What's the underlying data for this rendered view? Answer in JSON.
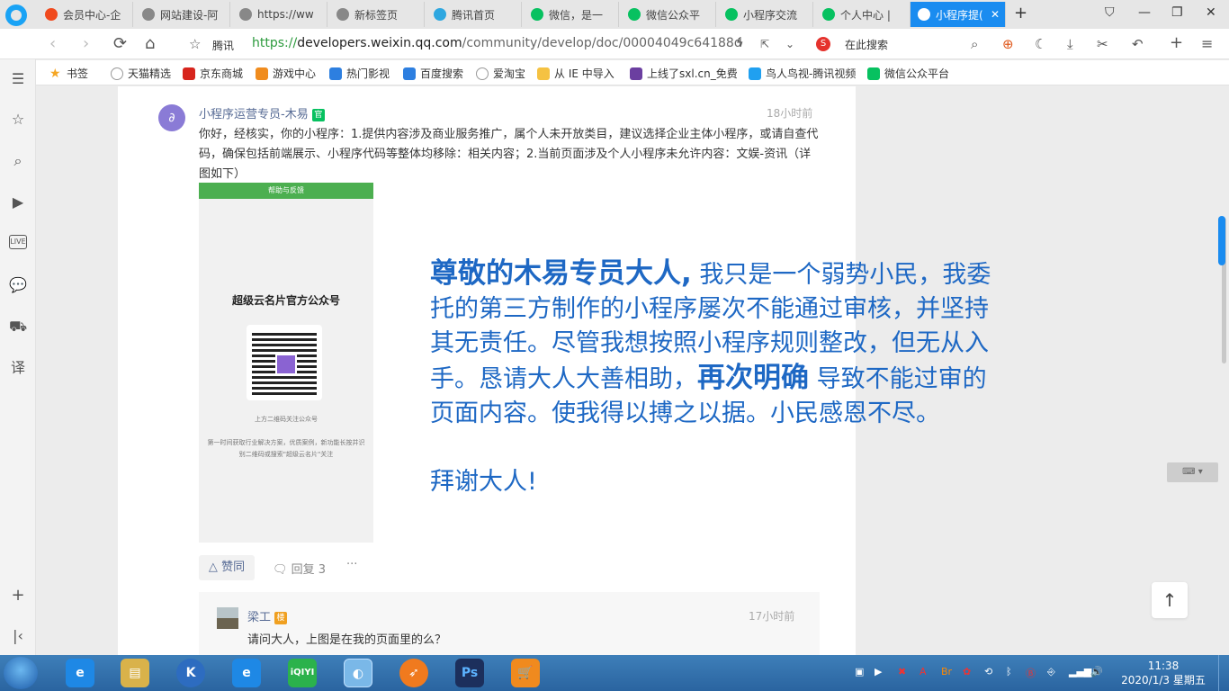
{
  "tabs": [
    {
      "label": "会员中心-企",
      "icon_color": "#f04a1e"
    },
    {
      "label": "网站建设-阿",
      "icon_color": "#888888"
    },
    {
      "label": "https://ww",
      "icon_color": "#888888"
    },
    {
      "label": "新标签页",
      "icon_color": "#888888"
    },
    {
      "label": "腾讯首页",
      "icon_color": "#2ea7e0"
    },
    {
      "label": "微信，是一",
      "icon_color": "#07c160"
    },
    {
      "label": "微信公众平",
      "icon_color": "#07c160"
    },
    {
      "label": "小程序交流",
      "icon_color": "#07c160"
    },
    {
      "label": "个人中心 |",
      "icon_color": "#07c160"
    },
    {
      "label": "小程序提(",
      "icon_color": "#ffffff",
      "active": true
    }
  ],
  "address": {
    "site_name": "腾讯",
    "url_scheme": "https://",
    "url_host": "developers.weixin.qq.com",
    "url_path": "/community/develop/doc/00004049c64188d",
    "search_placeholder": "在此搜索"
  },
  "bookmarks": [
    {
      "label": "书签",
      "icon": "star-icon",
      "color": "#f5a623"
    },
    {
      "label": "天猫精选",
      "icon": "globe-icon",
      "color": "#999999"
    },
    {
      "label": "京东商城",
      "icon": "jd-icon",
      "color": "#d7251d"
    },
    {
      "label": "游戏中心",
      "icon": "game-icon",
      "color": "#f08c1e"
    },
    {
      "label": "热门影视",
      "icon": "play-icon",
      "color": "#2d7fe0"
    },
    {
      "label": "百度搜索",
      "icon": "paw-icon",
      "color": "#2d7fe0"
    },
    {
      "label": "爱淘宝",
      "icon": "globe-icon",
      "color": "#999999"
    },
    {
      "label": "从 IE 中导入",
      "icon": "folder-icon",
      "color": "#f5c242"
    },
    {
      "label": "上线了sxl.cn_免费",
      "icon": "s-icon",
      "color": "#6b3fa0"
    },
    {
      "label": "鸟人鸟视-腾讯视频",
      "icon": "video-icon",
      "color": "#20a0f0"
    },
    {
      "label": "微信公众平台",
      "icon": "wechat-icon",
      "color": "#07c160"
    }
  ],
  "post": {
    "author": "小程序运营专员-木易",
    "official_badge": "官",
    "time": "18小时前",
    "text": "你好，经核实，你的小程序：1.提供内容涉及商业服务推广，属个人未开放类目，建议选择企业主体小程序，或请自查代码，确保包括前端展示、小程序代码等整体均移除：相关内容；2.当前页面涉及个人小程序未允许内容：文娱-资讯（详图如下）",
    "image": {
      "top_bar": "帮助与反馈",
      "title": "超级云名片官方公众号",
      "caption1": "上方二维码关注公众号",
      "caption2": "第一时间获取行业解决方案，优质案例，新功能长按并识别二维码或搜索\"超级云名片\"关注"
    },
    "like_label": "赞同",
    "reply_label": "回复 3",
    "more_label": "···"
  },
  "overlay": {
    "lead": "尊敬的木易专员大人,",
    "part1": "我只是一个弱势小民，我委托的第三方制作的小程序屡次不能通过审核，并坚持其无责任。尽管我想按照小程序规则整改，但无从入手。恳请大人大善相助，",
    "emph": "再次明确",
    "part2": "导致不能过审的页面内容。使我得以搏之以据。小民感恩不尽。",
    "thanks": "拜谢大人!"
  },
  "sub_reply": {
    "author": "梁工",
    "floor_badge": "楼",
    "time": "17小时前",
    "text": "请问大人，上图是在我的页面里的么？"
  },
  "clock": {
    "time": "11:38",
    "date": "2020/1/3 星期五"
  },
  "colors": {
    "accent": "#1a8cf0",
    "link": "#576b95",
    "overlay_text": "#1e68c4",
    "url_green": "#2b9a3c"
  }
}
